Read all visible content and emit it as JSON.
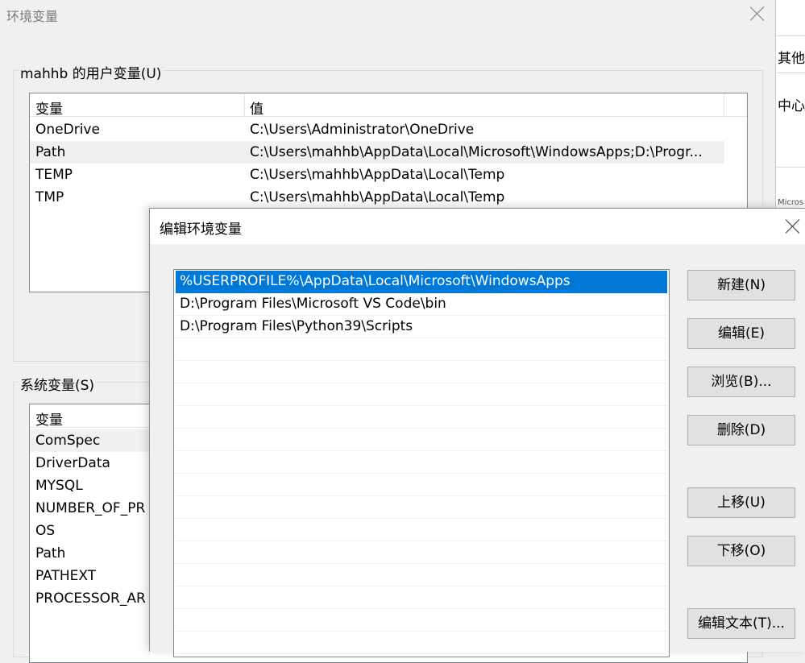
{
  "background_window": {
    "fragments": [
      "其他",
      "中心",
      "Micros"
    ]
  },
  "env_dialog": {
    "title": "环境变量",
    "user_vars": {
      "group_label": "mahhb 的用户变量(U)",
      "columns": [
        "变量",
        "值"
      ],
      "rows": [
        {
          "name": "OneDrive",
          "value": "C:\\Users\\Administrator\\OneDrive"
        },
        {
          "name": "Path",
          "value": "C:\\Users\\mahhb\\AppData\\Local\\Microsoft\\WindowsApps;D:\\Progr...",
          "selected": true
        },
        {
          "name": "TEMP",
          "value": "C:\\Users\\mahhb\\AppData\\Local\\Temp"
        },
        {
          "name": "TMP",
          "value": "C:\\Users\\mahhb\\AppData\\Local\\Temp"
        }
      ]
    },
    "system_vars": {
      "group_label": "系统变量(S)",
      "columns": [
        "变量"
      ],
      "rows": [
        {
          "name": "ComSpec",
          "selected": true
        },
        {
          "name": "DriverData"
        },
        {
          "name": "MYSQL"
        },
        {
          "name": "NUMBER_OF_PR"
        },
        {
          "name": "OS"
        },
        {
          "name": "Path"
        },
        {
          "name": "PATHEXT"
        },
        {
          "name": "PROCESSOR_AR"
        }
      ]
    }
  },
  "edit_dialog": {
    "title": "编辑环境变量",
    "paths": [
      {
        "text": "%USERPROFILE%\\AppData\\Local\\Microsoft\\WindowsApps",
        "selected": true
      },
      {
        "text": "D:\\Program Files\\Microsoft VS Code\\bin"
      },
      {
        "text": "D:\\Program Files\\Python39\\Scripts"
      }
    ],
    "buttons": {
      "new": "新建(N)",
      "edit": "编辑(E)",
      "browse": "浏览(B)...",
      "delete": "删除(D)",
      "move_up": "上移(U)",
      "move_down": "下移(O)",
      "edit_text": "编辑文本(T)..."
    }
  },
  "colors": {
    "selection": "#0078d7",
    "dialog_bg": "#f0f0f0"
  }
}
